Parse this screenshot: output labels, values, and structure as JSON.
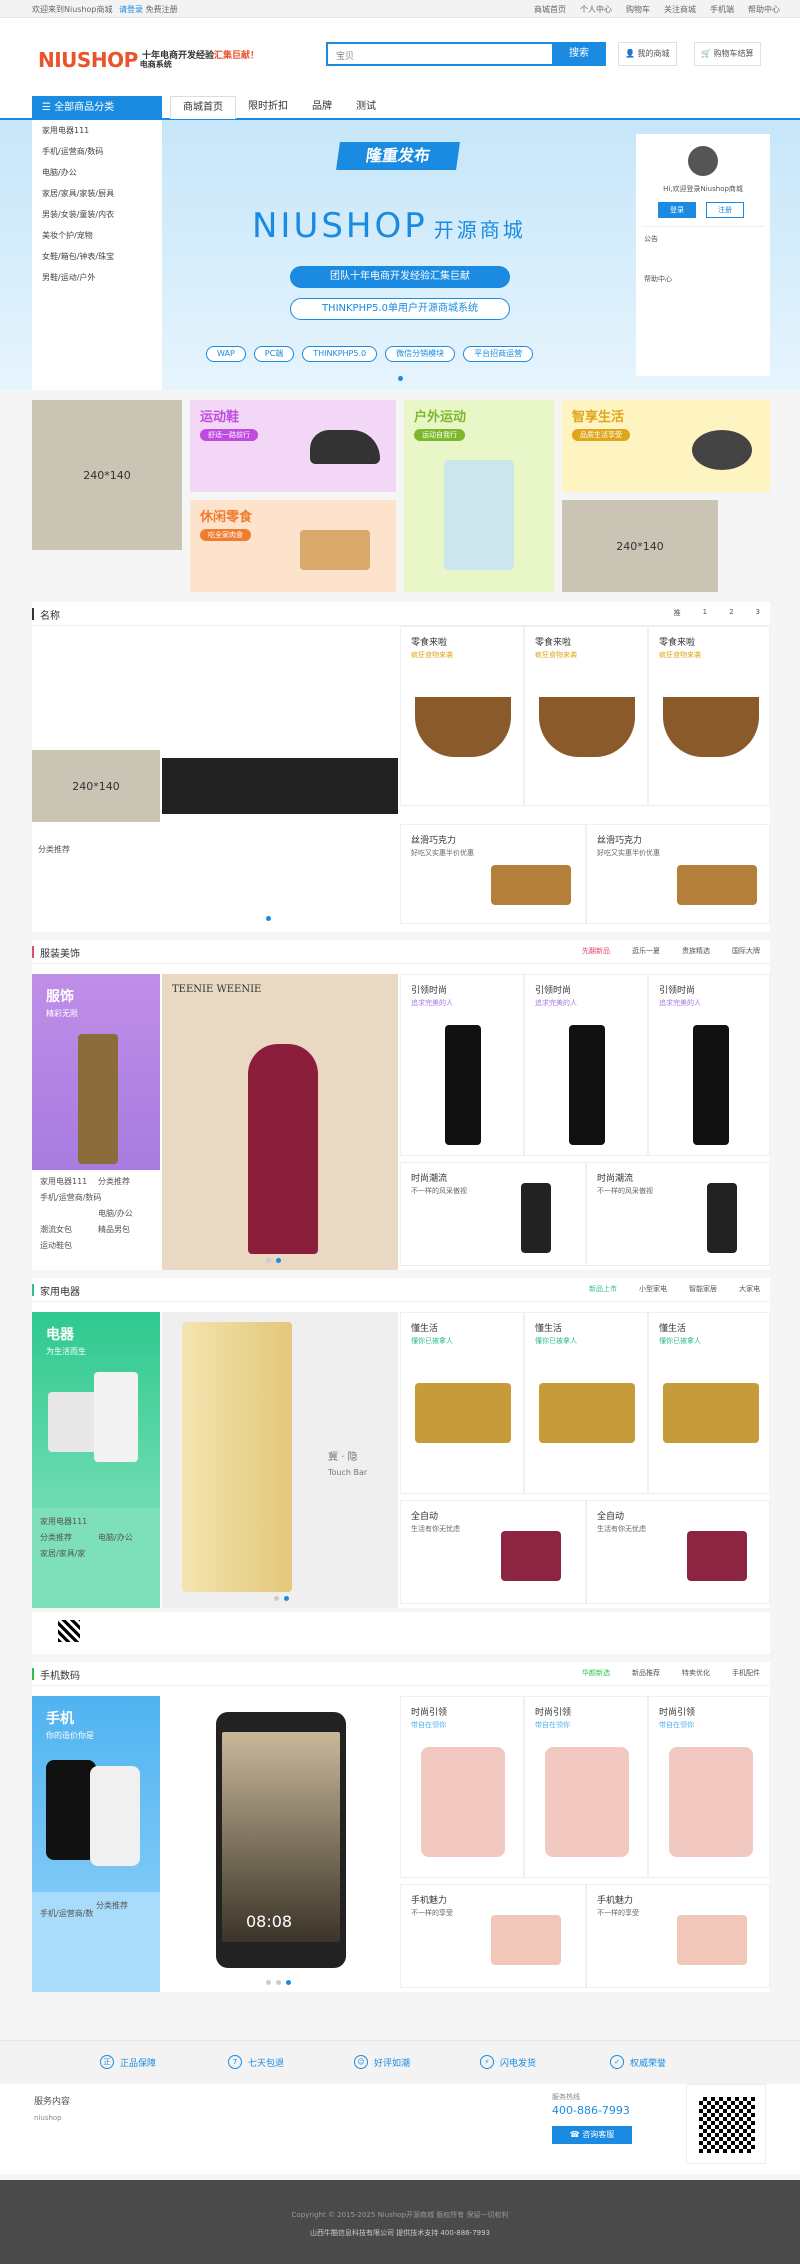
{
  "topbar": {
    "welcome": "欢迎来到Niushop商城",
    "login": "请登录",
    "register": "免费注册",
    "links": [
      "商城首页",
      "个人中心",
      "购物车",
      "关注商城",
      "手机端",
      "帮助中心"
    ]
  },
  "header": {
    "logo": "NIUSHOP",
    "logo_sub": "电商系统",
    "slogan_a": "十年电商开发经验",
    "slogan_b": "汇集巨献！",
    "search_placeholder": "宝贝",
    "search_btn": "搜索",
    "my_mall": "我的商城",
    "cart": "购物车结算"
  },
  "nav": {
    "category": "全部商品分类",
    "items": [
      "商城首页",
      "限时折扣",
      "品牌",
      "测试"
    ]
  },
  "categories": [
    "家用电器111",
    "手机/运营商/数码",
    "电脑/办公",
    "家居/家具/家装/厨具",
    "男装/女装/童装/内衣",
    "美妆个护/宠物",
    "女鞋/箱包/钟表/珠宝",
    "男鞋/运动/户外"
  ],
  "banner": {
    "ribbon": "隆重发布",
    "title": "NIUSHOP",
    "title_cn": "开源商城",
    "line1": "团队十年电商开发经验汇集巨献",
    "line2": "THINKPHP5.0单用户开源商城系统",
    "tags": [
      "WAP",
      "PC端",
      "THINKPHP5.0",
      "微信分销模块",
      "平台招商运营"
    ]
  },
  "user": {
    "welcome": "Hi,欢迎登录Niushop商城",
    "login": "登录",
    "register": "注册",
    "notice": "公告",
    "help": "帮助中心"
  },
  "promo": {
    "gray1": "240*140",
    "gray2": "240*140",
    "c1_title": "运动鞋",
    "c1_sub": "舒适一路前行",
    "c2_title": "户外运动",
    "c2_sub": "运动自我行",
    "c3_title": "智享生活",
    "c3_sub": "品质生活享受",
    "c4_title": "休闲零食",
    "c4_sub": "吃全家肉食"
  },
  "floor1": {
    "title": "名称",
    "tabs": [
      "推",
      "1",
      "2",
      "3"
    ],
    "gray": "240*140",
    "recommend": "分类推荐",
    "products": [
      {
        "title": "零食来啦",
        "sub": "疯狂食物来袭"
      },
      {
        "title": "零食来啦",
        "sub": "疯狂食物来袭"
      },
      {
        "title": "零食来啦",
        "sub": "疯狂食物来袭"
      }
    ],
    "bottom": [
      {
        "title": "丝滑巧克力",
        "sub": "好吃又实惠半价优惠"
      },
      {
        "title": "丝滑巧克力",
        "sub": "好吃又实惠半价优惠"
      }
    ]
  },
  "floor2": {
    "title": "服装美饰",
    "tabs": [
      "先翻新品",
      "逛乐一夏",
      "贵族精选",
      "国际大牌"
    ],
    "left_title": "服饰",
    "left_sub": "精彩无限",
    "brand": "TEENIE WEENIE",
    "links": [
      "家用电器111",
      "分类推荐",
      "手机/运营商/数码",
      "电脑/办公",
      "潮流女包",
      "精品男包",
      "运动鞋包"
    ],
    "products": [
      {
        "title": "引领时尚",
        "sub": "追求完美的人"
      },
      {
        "title": "引领时尚",
        "sub": "追求完美的人"
      },
      {
        "title": "引领时尚",
        "sub": "追求完美的人"
      }
    ],
    "bottom": [
      {
        "title": "时尚潮流",
        "sub": "不一样的风采傲视"
      },
      {
        "title": "时尚潮流",
        "sub": "不一样的风采傲视"
      }
    ]
  },
  "floor3": {
    "title": "家用电器",
    "tabs": [
      "新品上市",
      "小型家电",
      "智能家居",
      "大家电"
    ],
    "left_title": "电器",
    "left_sub": "为生活而生",
    "touch": "冀 · 隐",
    "touch_sub": "Touch Bar",
    "links": [
      "家用电器111",
      "分类推荐",
      "电脑/办公",
      "家居/家具/家"
    ],
    "products": [
      {
        "title": "懂生活",
        "sub": "懂你已被拿人"
      },
      {
        "title": "懂生活",
        "sub": "懂你已被拿人"
      },
      {
        "title": "懂生活",
        "sub": "懂你已被拿人"
      }
    ],
    "bottom": [
      {
        "title": "全自动",
        "sub": "生活有你无忧虑"
      },
      {
        "title": "全自动",
        "sub": "生活有你无忧虑"
      }
    ]
  },
  "floor4": {
    "title": "手机数码",
    "tabs": [
      "华颜新选",
      "新品推荐",
      "特卖优化",
      "手机配件"
    ],
    "left_title": "手机",
    "left_sub": "你的造价你是",
    "links": [
      "手机/运营商/数",
      "分类推荐"
    ],
    "clock": "08:08",
    "products": [
      {
        "title": "时尚引领",
        "sub": "带自在领你"
      },
      {
        "title": "时尚引领",
        "sub": "带自在领你"
      },
      {
        "title": "时尚引领",
        "sub": "带自在领你"
      }
    ],
    "bottom": [
      {
        "title": "手机魅力",
        "sub": "不一样的享受"
      },
      {
        "title": "手机魅力",
        "sub": "不一样的享受"
      }
    ]
  },
  "service": [
    "正品保障",
    "七天包退",
    "好评如潮",
    "闪电发货",
    "权威荣誉"
  ],
  "info": {
    "left_title": "服务内容",
    "left_sub": "niushop",
    "hotline_label": "服务热线",
    "hotline": "400-886-7993",
    "online": "咨询客服"
  },
  "copyright": {
    "line1": "Copyright © 2015-2025 Niushop开源商城 版权所有 保留一切权利",
    "line2": "山西牛酷信息科技有限公司   提供技术支持 400-886-7993"
  }
}
